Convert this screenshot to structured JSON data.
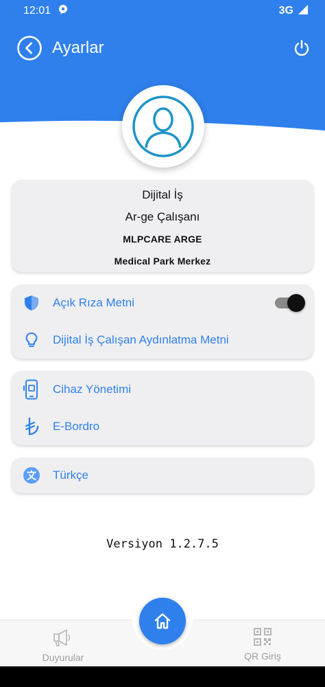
{
  "status_bar": {
    "time": "12:01",
    "network": "3G"
  },
  "header": {
    "title": "Ayarlar"
  },
  "profile": {
    "name": "Dijital İş",
    "role": "Ar-ge Çalışanı",
    "company": "MLPCARE ARGE",
    "location": "Medical Park Merkez"
  },
  "menu": {
    "consent": {
      "label": "Açık Rıza Metni",
      "toggle_on": true
    },
    "disclosure": {
      "label": "Dijital İş Çalışan Aydınlatma Metni"
    },
    "device": {
      "label": "Cihaz Yönetimi"
    },
    "payroll": {
      "label": "E-Bordro"
    },
    "language": {
      "label": "Türkçe"
    }
  },
  "version": "Versiyon 1.2.7.5",
  "bottom_nav": {
    "left": {
      "label": "Duyurular"
    },
    "right": {
      "label": "QR Giriş"
    }
  },
  "colors": {
    "primary": "#2f80ed",
    "card": "#efeff1",
    "muted": "#9e9e9e"
  },
  "icons": {
    "back": "back-arrow-circle-icon",
    "power": "power-icon",
    "avatar": "user-avatar-icon",
    "consent": "shield-icon",
    "disclosure": "lightbulb-icon",
    "device": "phone-device-icon",
    "payroll": "lira-icon",
    "language": "translate-icon",
    "announcements": "megaphone-icon",
    "qr": "qr-code-icon",
    "home": "home-icon"
  }
}
